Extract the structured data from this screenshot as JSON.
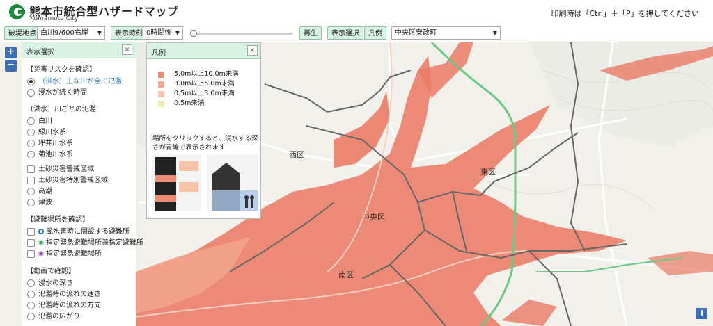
{
  "header": {
    "title": "熊本市統合型ハザードマップ",
    "subtitle": "Kumamoto City",
    "print_hint": "印刷時は「Ctrl」＋「P」を押してください",
    "brand_color": "#1a8b3a"
  },
  "toolbar": {
    "breach_label": "破堤地点",
    "breach_value": "白川9/600右岸",
    "time_label": "表示時刻",
    "time_value": "0時間後",
    "play_label": "再生",
    "display_select_label": "表示選択",
    "legend_label": "凡例",
    "area_value": "中央区安政町",
    "slider_fraction": 0.0
  },
  "zoom": {
    "in": "+",
    "out": "−"
  },
  "panel": {
    "title": "表示選択",
    "close": "×",
    "sections": {
      "risk": "【災害リスクを確認】",
      "river": "（洪水）川ごとの氾濫",
      "shelter": "【避難場所を確認】",
      "video": "【動画で確認】"
    },
    "risk_items": [
      "（洪水）主な川が全て氾濫",
      "浸水が続く時間"
    ],
    "river_items": [
      "白川",
      "緑川水系",
      "坪井川水系",
      "菊池川水系"
    ],
    "hazard_items": [
      "土砂災害警戒区域",
      "土砂災害特別警戒区域"
    ],
    "misc_items": [
      "高潮",
      "津波"
    ],
    "shelter_items": [
      "風水害時に開設する避難所",
      "指定緊急避難場所兼指定避難所",
      "指定緊急避難場所"
    ],
    "video_items": [
      "浸水の深さ",
      "氾濫時の流れの速さ",
      "氾濫時の流れの方向",
      "氾濫の広がり"
    ]
  },
  "legend": {
    "title": "凡例",
    "close": "×",
    "items": [
      {
        "label": "5.0m以上10.0m未満",
        "color": "#ee8c74"
      },
      {
        "label": "3.0m以上5.0m未満",
        "color": "#f2a98e"
      },
      {
        "label": "0.5m以上3.0m未満",
        "color": "#f6c4a9"
      },
      {
        "label": "0.5m未満",
        "color": "#f3eab0"
      }
    ],
    "note": "場所をクリックすると、浸水する深さが青線で表示されます"
  },
  "map_labels": {
    "west": "西区",
    "east": "東区",
    "south": "南区",
    "kita_chuo": "中央区"
  },
  "info": "i",
  "colors": {
    "flood": "#ea7b66",
    "flood_light": "#f2a28c",
    "district_border": "#666666",
    "rail": "#6cc784",
    "panel_header": "#d8f3e3",
    "zoom_button": "#3d6fb8"
  }
}
